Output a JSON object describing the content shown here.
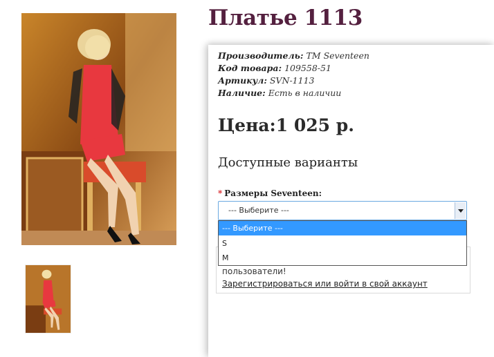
{
  "product": {
    "title": "Платье 1113"
  },
  "meta": {
    "manufacturer_label": "Производитель:",
    "manufacturer_value": "TM Seventeen",
    "code_label": "Код товара:",
    "code_value": "109558-51",
    "article_label": "Артикул:",
    "article_value": "SVN-1113",
    "availability_label": "Наличие:",
    "availability_value": "Есть в наличии"
  },
  "price": {
    "text": "Цена:1 025 р."
  },
  "variants": {
    "heading": "Доступные варианты",
    "required_mark": "*",
    "size_label": "Размеры Seventeen:",
    "selected": "--- Выберите ---",
    "options": [
      "--- Выберите ---",
      "S",
      "M"
    ]
  },
  "login": {
    "text": "пользователи!",
    "link": "Зарегистрироваться или войти в свой аккаунт"
  },
  "colors": {
    "title": "#54203f",
    "dress": "#e8383f",
    "selected_option": "#3399ff"
  }
}
